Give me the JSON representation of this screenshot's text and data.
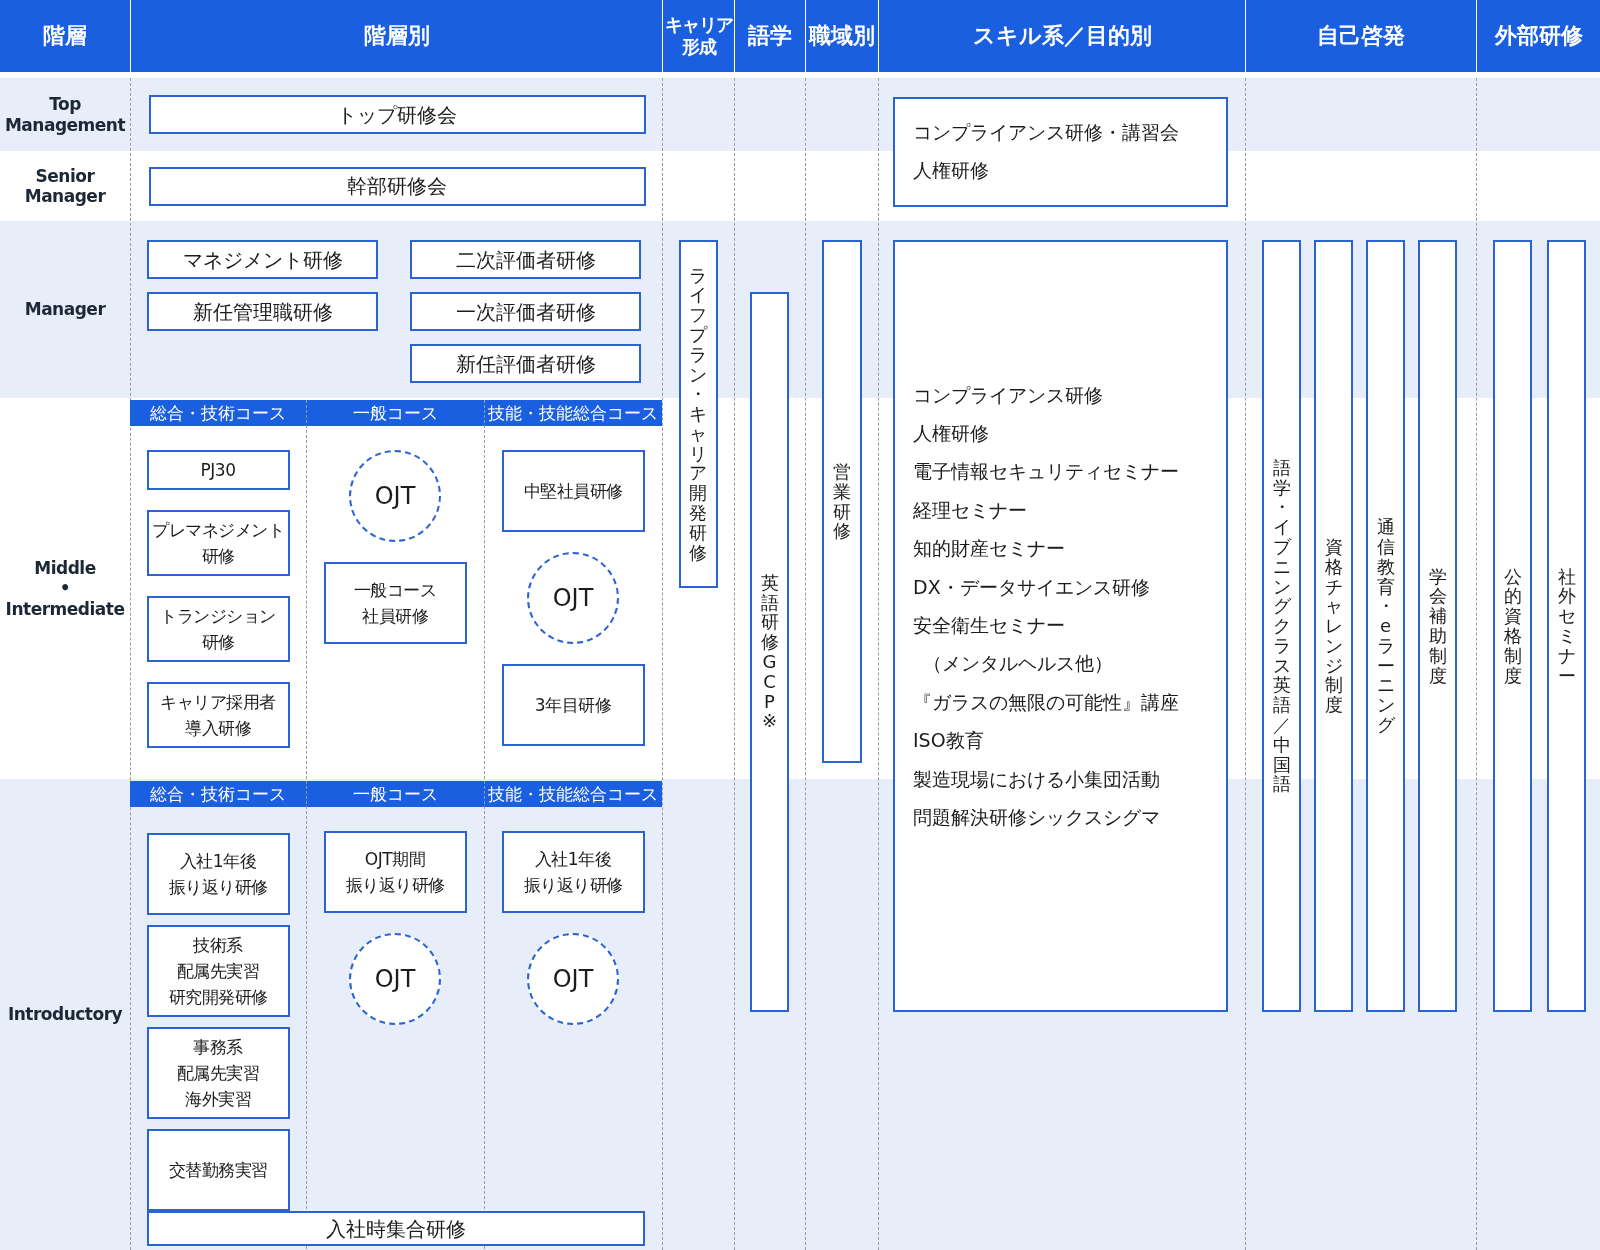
{
  "header": [
    {
      "lines": [
        "階層"
      ]
    },
    {
      "lines": [
        "階層別"
      ]
    },
    {
      "lines": [
        "キャリア",
        "形成"
      ]
    },
    {
      "lines": [
        "語学"
      ]
    },
    {
      "lines": [
        "職域別"
      ]
    },
    {
      "lines": [
        "スキル系／目的別"
      ]
    },
    {
      "lines": [
        "自己啓発"
      ]
    },
    {
      "lines": [
        "外部研修"
      ]
    }
  ],
  "levels": [
    {
      "lines": [
        "Top",
        "Management"
      ],
      "shaded": true
    },
    {
      "lines": [
        "Senior",
        "Manager"
      ],
      "shaded": false
    },
    {
      "lines": [
        "Manager"
      ],
      "shaded": true
    },
    {
      "lines": [
        "Middle",
        "•",
        "Intermediate"
      ],
      "shaded": false
    },
    {
      "lines": [
        "Introductory"
      ],
      "shaded": true
    }
  ],
  "by_level": {
    "top": {
      "lines": [
        "トップ研修会"
      ]
    },
    "senior": {
      "lines": [
        "幹部研修会"
      ]
    },
    "manager": {
      "columns": [
        [
          {
            "kind": "box",
            "lines": [
              "マネジメント研修"
            ]
          },
          {
            "kind": "box",
            "lines": [
              "新任管理職研修"
            ]
          }
        ],
        [
          {
            "kind": "box",
            "lines": [
              "二次評価者研修"
            ]
          },
          {
            "kind": "box",
            "lines": [
              "一次評価者研修"
            ]
          },
          {
            "kind": "box",
            "lines": [
              "新任評価者研修"
            ]
          }
        ]
      ]
    },
    "middle": {
      "courses": [
        "総合・技術コース",
        "一般コース",
        "技能・技能総合コース"
      ],
      "columns": [
        [
          {
            "kind": "box",
            "lines": [
              "PJ30"
            ]
          },
          {
            "kind": "box",
            "lines": [
              "プレマネジメント",
              "研修"
            ]
          },
          {
            "kind": "box",
            "lines": [
              "トランジション",
              "研修"
            ]
          },
          {
            "kind": "box",
            "lines": [
              "キャリア採用者",
              "導入研修"
            ]
          }
        ],
        [
          {
            "kind": "circle",
            "lines": [
              "OJT"
            ]
          },
          {
            "kind": "box",
            "lines": [
              "一般コース",
              "社員研修"
            ]
          }
        ],
        [
          {
            "kind": "box",
            "lines": [
              "中堅社員研修"
            ]
          },
          {
            "kind": "circle",
            "lines": [
              "OJT"
            ]
          },
          {
            "kind": "box",
            "lines": [
              "3年目研修"
            ]
          }
        ]
      ]
    },
    "introductory": {
      "courses": [
        "総合・技術コース",
        "一般コース",
        "技能・技能総合コース"
      ],
      "columns": [
        [
          {
            "kind": "box",
            "lines": [
              "入社1年後",
              "振り返り研修"
            ]
          },
          {
            "kind": "box",
            "lines": [
              "技術系",
              "配属先実習",
              "研究開発研修"
            ]
          },
          {
            "kind": "box",
            "lines": [
              "事務系",
              "配属先実習",
              "海外実習"
            ]
          },
          {
            "kind": "box",
            "lines": [
              "交替勤務実習"
            ]
          }
        ],
        [
          {
            "kind": "box",
            "lines": [
              "OJT期間",
              "振り返り研修"
            ]
          },
          {
            "kind": "circle",
            "lines": [
              "OJT"
            ]
          }
        ],
        [
          {
            "kind": "box",
            "lines": [
              "入社1年後",
              "振り返り研修"
            ]
          },
          {
            "kind": "circle",
            "lines": [
              "OJT"
            ]
          }
        ]
      ],
      "joint": {
        "lines": [
          "入社時集合研修"
        ]
      }
    }
  },
  "career": "ライフプラン・キャリア開発研修",
  "language": "英語研修GCP※",
  "job": "営業研修",
  "skills": {
    "executive": [
      {
        "kind": "item",
        "text": "コンプライアンス研修・講習会"
      },
      {
        "kind": "item",
        "text": "人権研修"
      }
    ],
    "general": [
      {
        "kind": "item",
        "text": "コンプライアンス研修"
      },
      {
        "kind": "item",
        "text": "人権研修"
      },
      {
        "kind": "item",
        "text": "電子情報セキュリティセミナー"
      },
      {
        "kind": "item",
        "text": "経理セミナー"
      },
      {
        "kind": "item",
        "text": "知的財産セミナー"
      },
      {
        "kind": "item",
        "text": "DX・データサイエンス研修"
      },
      {
        "kind": "item",
        "text": "安全衛生セミナー"
      },
      {
        "kind": "continuation",
        "text": "（メンタルヘルス他）"
      },
      {
        "kind": "item",
        "text": "『ガラスの無限の可能性』講座"
      },
      {
        "kind": "item",
        "text": "ISO教育"
      },
      {
        "kind": "item",
        "text": "製造現場における小集団活動"
      },
      {
        "kind": "item",
        "text": "問題解決研修シックスシグマ"
      }
    ]
  },
  "self_development": [
    "語学・イブニングクラス英語／中国語",
    "資格チャレンジ制度",
    "通信教育・eラーニング",
    "学会補助制度"
  ],
  "external": [
    "公的資格制度",
    "社外セミナー"
  ]
}
